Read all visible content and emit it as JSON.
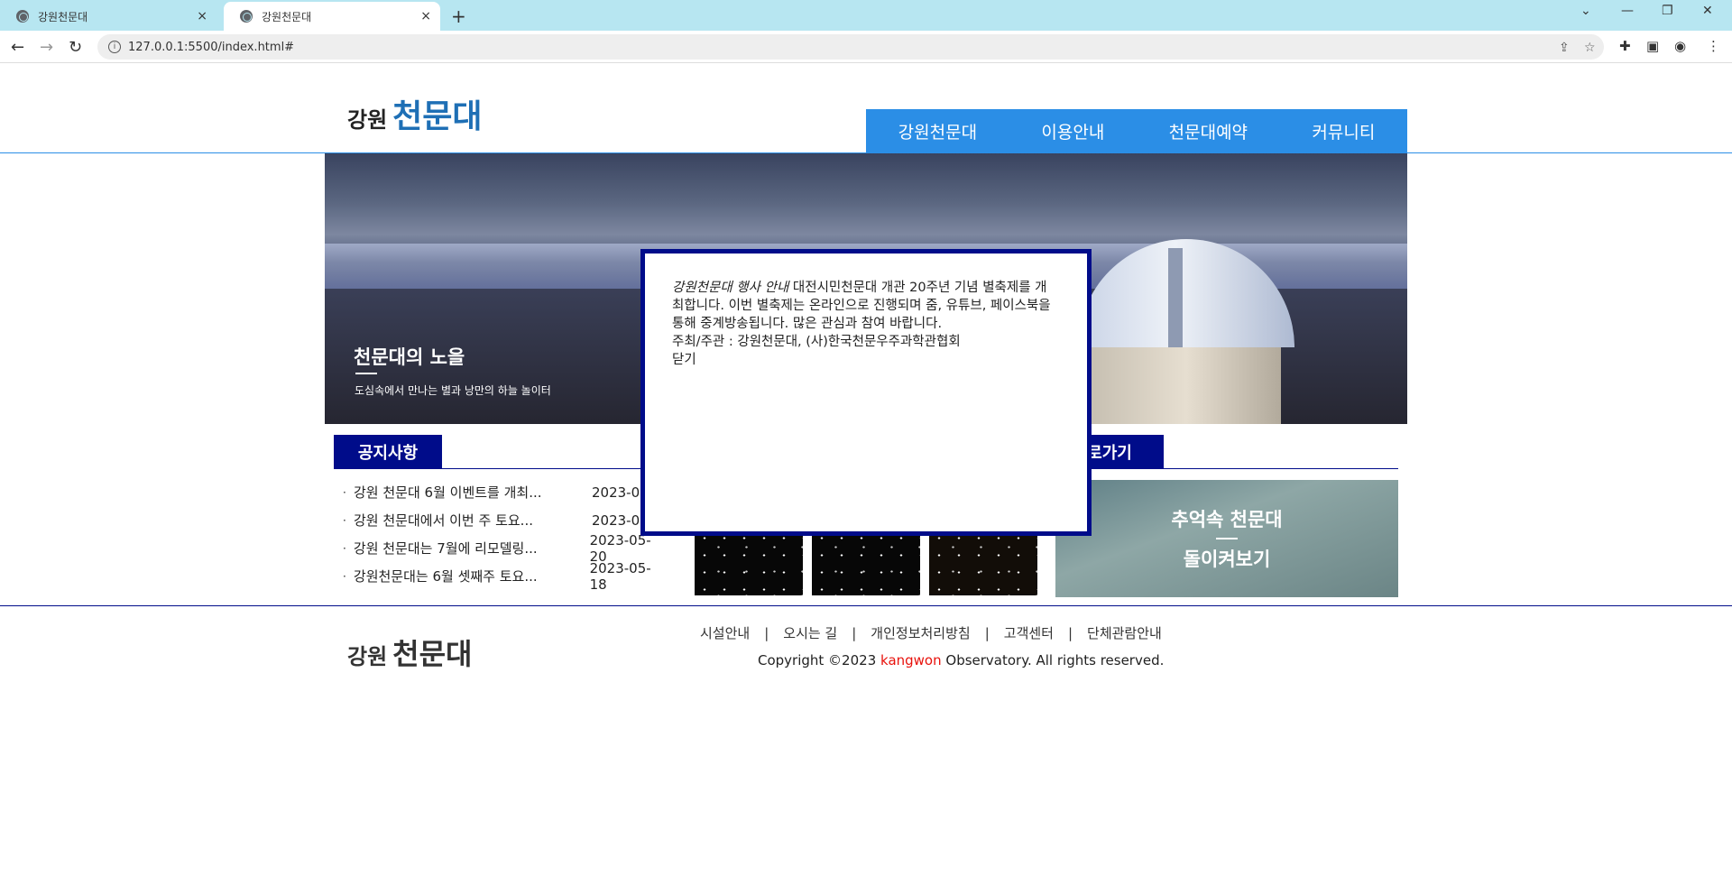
{
  "browser": {
    "tabs": [
      {
        "title": "강원천문대",
        "close": "×"
      },
      {
        "title": "강원천문대",
        "close": "×"
      }
    ],
    "new_tab": "+",
    "url": "127.0.0.1:5500/index.html#",
    "window_controls": {
      "dropdown": "⌄",
      "minimize": "—",
      "restore": "❐",
      "close": "✕"
    }
  },
  "header": {
    "logo_small": "강원",
    "logo_big": "천문대",
    "nav": [
      "강원천문대",
      "이용안내",
      "천문대예약",
      "커뮤니티"
    ]
  },
  "hero": {
    "title": "천문대의 노을",
    "subtitle": "도심속에서 만나는 별과 낭만의 하늘 놀이터"
  },
  "notice": {
    "tab_label": "공지사항",
    "items": [
      {
        "text": "강원 천문대 6월 이벤트를 개최...",
        "date": "2023-06"
      },
      {
        "text": "강원 천문대에서 이번 주 토요...",
        "date": "2023-06"
      },
      {
        "text": "강원 천문대는 7월에 리모델링...",
        "date": "2023-05-20"
      },
      {
        "text": "강원천문대는 6월 셋째주 토요...",
        "date": "2023-05-18"
      }
    ]
  },
  "shortcut": {
    "tab_label": "로가기",
    "memory_line1": "추억속 천문대",
    "memory_line2": "돌이켜보기"
  },
  "modal": {
    "lead": "강원천문대 행사 안내",
    "body": " 대전시민천문대 개관 20주년 기념 별축제를 개최합니다. 이번 별축제는 온라인으로 진행되며 줌, 유튜브, 페이스북을 통해 중계방송됩니다. 많은 관심과 참여 바랍니다.",
    "host": "주최/주관 : 강원천문대, (사)한국천문우주과학관협회",
    "close": "닫기"
  },
  "footer": {
    "logo_small": "강원",
    "logo_big": "천문대",
    "links": [
      "시설안내",
      "오시는 길",
      "개인정보처리방침",
      "고객센터",
      "단체관람안내"
    ],
    "separator": "|",
    "copyright_prefix": "Copyright ©2023 ",
    "copyright_brand": "kangwon",
    "copyright_suffix": " Observatory. All rights reserved."
  }
}
